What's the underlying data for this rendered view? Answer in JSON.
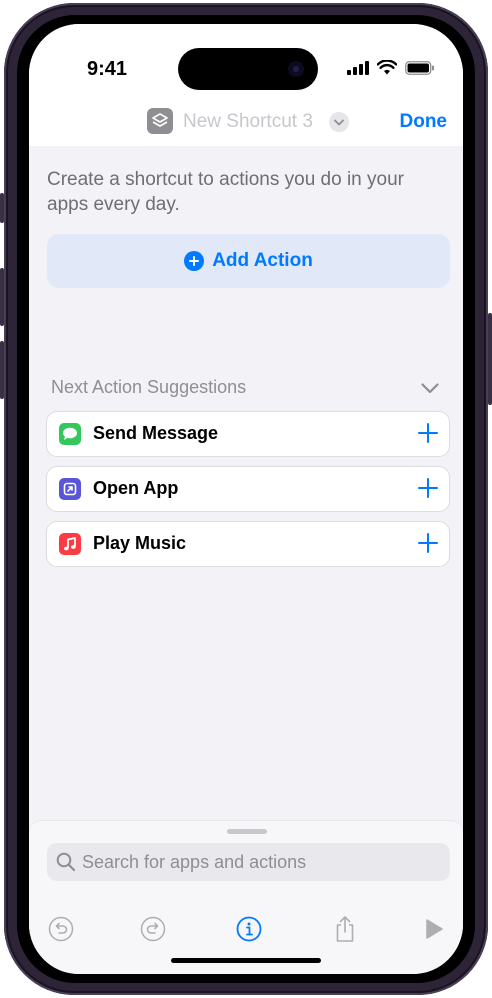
{
  "status_bar": {
    "time": "9:41"
  },
  "nav": {
    "title": "New Shortcut 3",
    "done_label": "Done"
  },
  "intro": {
    "text": "Create a shortcut to actions you do in your apps every day."
  },
  "add_action": {
    "label": "Add Action"
  },
  "suggestions": {
    "title": "Next Action Suggestions",
    "items": [
      {
        "label": "Send Message",
        "icon": "messages-icon",
        "color": "#34c759"
      },
      {
        "label": "Open App",
        "icon": "open-app-icon",
        "color": "#5856d6"
      },
      {
        "label": "Play Music",
        "icon": "music-icon",
        "color": "#fc3c44"
      }
    ]
  },
  "search": {
    "placeholder": "Search for apps and actions"
  },
  "toolbar": {
    "buttons": [
      "undo-icon",
      "redo-icon",
      "info-icon",
      "share-icon",
      "play-icon"
    ]
  },
  "colors": {
    "accent": "#007aff",
    "background": "#f2f2f7",
    "phone_frame": "#2d2438"
  }
}
